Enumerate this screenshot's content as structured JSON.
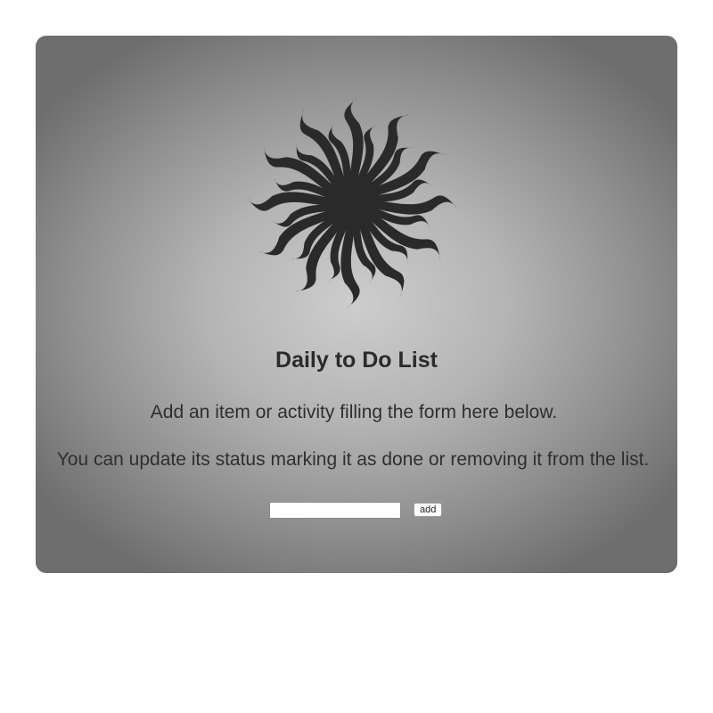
{
  "header": {
    "title": "Daily to Do List"
  },
  "intro": {
    "line1": "Add an item or activity filling the form here below.",
    "line2": "You can update its status marking it as done or removing it from the list."
  },
  "form": {
    "input_value": "",
    "input_placeholder": "",
    "add_label": "add"
  },
  "logo": {
    "icon": "sun-burst-icon",
    "color": "#2a2a2a"
  },
  "colors": {
    "card_center": "#cdcdcd",
    "card_edge": "#6e6e6e",
    "text": "#2b2b2b"
  }
}
